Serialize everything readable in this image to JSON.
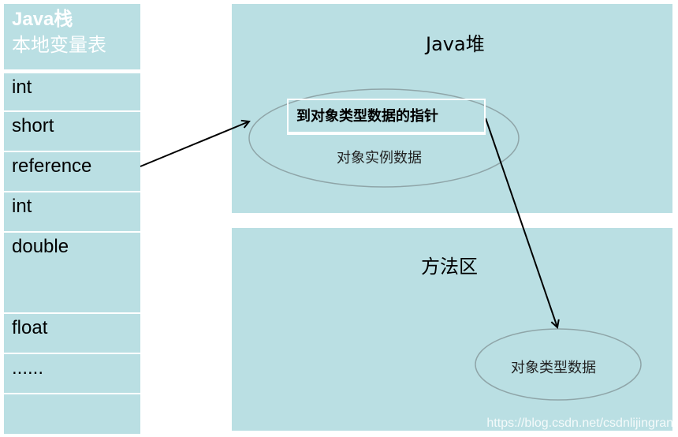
{
  "stack": {
    "title": "Java栈",
    "subtitle": "本地变量表",
    "rows": [
      "int",
      "short",
      "reference",
      "int",
      "double",
      "",
      "float",
      "......",
      ""
    ]
  },
  "heap": {
    "title": "Java堆",
    "object": {
      "pointer_label": "到对象类型数据的指针",
      "instance_label": "对象实例数据"
    }
  },
  "method_area": {
    "title": "方法区",
    "type_data_label": "对象类型数据"
  },
  "watermark": "https://blog.csdn.net/csdnlijingran",
  "colors": {
    "panel": "#badfe3",
    "text_header": "#ffffff",
    "ellipse_stroke": "#8fa5a8",
    "arrow": "#000000"
  }
}
